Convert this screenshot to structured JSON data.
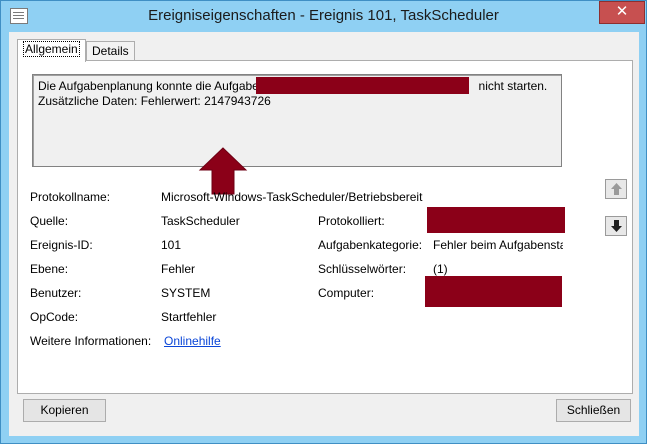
{
  "window": {
    "title": "Ereigniseigenschaften - Ereignis 101, TaskScheduler",
    "close_symbol": "✕"
  },
  "tabs": [
    {
      "label": "Allgemein"
    },
    {
      "label": "Details"
    }
  ],
  "description": {
    "line1_prefix": "Die Aufgabenplanung konnte die Aufgabe",
    "line1_suffix": "nicht starten.",
    "line2": "Zusätzliche Daten: Fehlerwert: 2147943726"
  },
  "fields": {
    "protokollname": {
      "label": "Protokollname:",
      "value": "Microsoft-Windows-TaskScheduler/Betriebsbereit"
    },
    "quelle": {
      "label": "Quelle:",
      "value": "TaskScheduler"
    },
    "protokolliert": {
      "label": "Protokolliert:",
      "value": ""
    },
    "ereignis_id": {
      "label": "Ereignis-ID:",
      "value": "101"
    },
    "aufgabenkategorie": {
      "label": "Aufgabenkategorie:",
      "value": "Fehler beim Aufgabenstart"
    },
    "ebene": {
      "label": "Ebene:",
      "value": "Fehler"
    },
    "schluesselwoerter": {
      "label": "Schlüsselwörter:",
      "value": "(1)"
    },
    "benutzer": {
      "label": "Benutzer:",
      "value": "SYSTEM"
    },
    "computer": {
      "label": "Computer:",
      "value": ""
    },
    "opcode": {
      "label": "OpCode:",
      "value": "Startfehler"
    },
    "weitere_informationen": {
      "label": "Weitere Informationen:",
      "link": "Onlinehilfe"
    }
  },
  "buttons": {
    "copy": "Kopieren",
    "close": "Schließen"
  },
  "colors": {
    "redaction": "#8b0018",
    "title_bar": "#8fd0f3",
    "close_button": "#c75050",
    "link": "#0b46d8"
  }
}
